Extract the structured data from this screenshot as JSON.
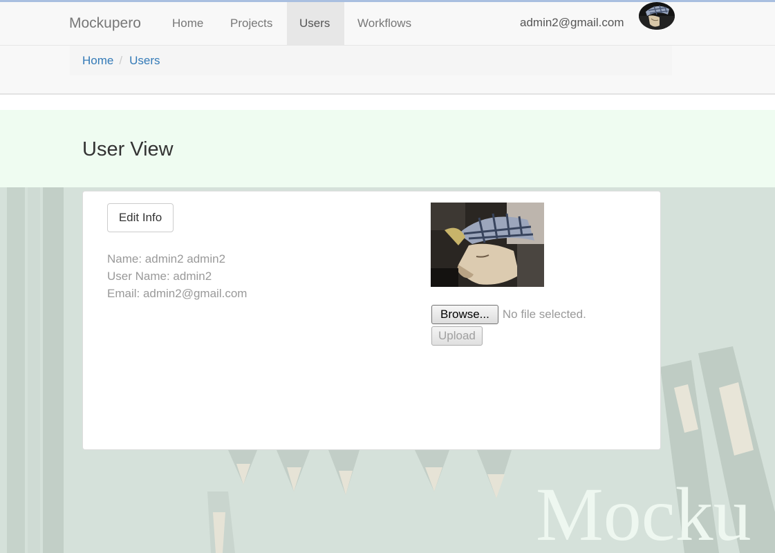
{
  "navbar": {
    "brand": "Mockupero",
    "links": [
      {
        "label": "Home",
        "active": false
      },
      {
        "label": "Projects",
        "active": false
      },
      {
        "label": "Users",
        "active": true
      },
      {
        "label": "Workflows",
        "active": false
      }
    ],
    "user_email": "admin2@gmail.com"
  },
  "breadcrumb": {
    "items": [
      "Home",
      "Users"
    ],
    "separator": "/"
  },
  "page": {
    "title": "User View"
  },
  "card": {
    "edit_button": "Edit Info",
    "info": {
      "name": "Name: admin2 admin2",
      "username": "User Name: admin2",
      "email": "Email: admin2@gmail.com"
    },
    "file_input": {
      "browse_label": "Browse...",
      "status": "No file selected."
    },
    "upload_button": "Upload"
  },
  "background": {
    "watermark": "Mocku"
  },
  "colors": {
    "link": "#337ab7",
    "navbar_bg": "#f8f8f8",
    "active_nav_bg": "#e7e7e7",
    "header_band": "#effcf1",
    "muted_text": "#999999"
  },
  "icons": [
    "user-avatar-photo",
    "profile-photo"
  ]
}
